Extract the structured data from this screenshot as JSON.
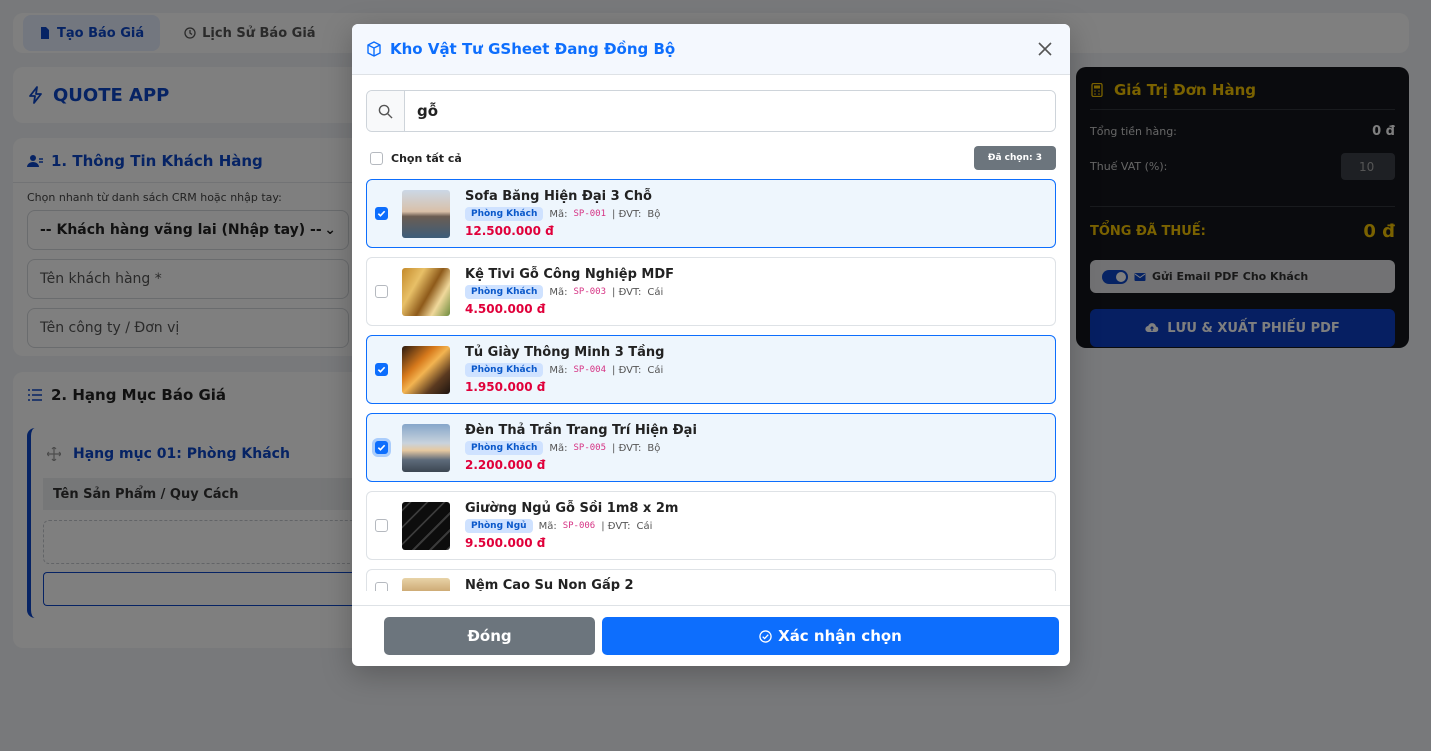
{
  "background": {
    "tabs": [
      {
        "label": "Tạo Báo Giá",
        "icon": "file-icon",
        "active": true
      },
      {
        "label": "Lịch Sử Báo Giá",
        "icon": "clock-icon",
        "active": false
      }
    ],
    "brand": "QUOTE APP",
    "customer": {
      "title": "1. Thông Tin Khách Hàng",
      "hint": "Chọn nhanh từ danh sách CRM hoặc nhập tay:",
      "select_value": "-- Khách hàng vãng lai (Nhập tay) --",
      "name_placeholder": "Tên khách hàng *",
      "company_placeholder": "Tên công ty / Đơn vị"
    },
    "items_section": {
      "title": "2. Hạng Mục Báo Giá",
      "group_title": "Hạng mục 01: Phòng Khách",
      "column_header": "Tên Sản Phẩm / Quy Cách"
    },
    "order": {
      "title": "Giá Trị Đơn Hàng",
      "subtotal_label": "Tổng tiền hàng:",
      "subtotal_value": "0 đ",
      "vat_label": "Thuế VAT (%):",
      "vat_value": "10",
      "total_label": "TỔNG ĐÃ THUẾ:",
      "total_value": "0 đ",
      "email_label": "Gửi Email PDF Cho Khách",
      "save_label": "LƯU & XUẤT PHIẾU PDF"
    }
  },
  "modal": {
    "title": "Kho Vật Tư GSheet Đang Đồng Bộ",
    "search_value": "gỗ",
    "select_all_label": "Chọn tất cả",
    "selected_count": "Đã chọn: 3",
    "code_prefix": "Mã:",
    "unit_prefix": "| ĐVT:",
    "products": [
      {
        "name": "Sofa Băng Hiện Đại 3 Chỗ",
        "category": "Phòng Khách",
        "code": "SP-001",
        "unit": "Bộ",
        "price": "12.500.000 đ",
        "checked": true
      },
      {
        "name": "Kệ Tivi Gỗ Công Nghiệp MDF",
        "category": "Phòng Khách",
        "code": "SP-003",
        "unit": "Cái",
        "price": "4.500.000 đ",
        "checked": false
      },
      {
        "name": "Tủ Giày Thông Minh 3 Tầng",
        "category": "Phòng Khách",
        "code": "SP-004",
        "unit": "Cái",
        "price": "1.950.000 đ",
        "checked": true
      },
      {
        "name": "Đèn Thả Trần Trang Trí Hiện Đại",
        "category": "Phòng Khách",
        "code": "SP-005",
        "unit": "Bộ",
        "price": "2.200.000 đ",
        "checked": true
      },
      {
        "name": "Giường Ngủ Gỗ Sồi 1m8 x 2m",
        "category": "Phòng Ngủ",
        "code": "SP-006",
        "unit": "Cái",
        "price": "9.500.000 đ",
        "checked": false
      },
      {
        "name": "Nệm Cao Su Non Gấp 2",
        "category": "",
        "code": "",
        "unit": "",
        "price": "",
        "checked": false
      }
    ],
    "close_label": "Đóng",
    "confirm_label": "Xác nhận chọn"
  }
}
